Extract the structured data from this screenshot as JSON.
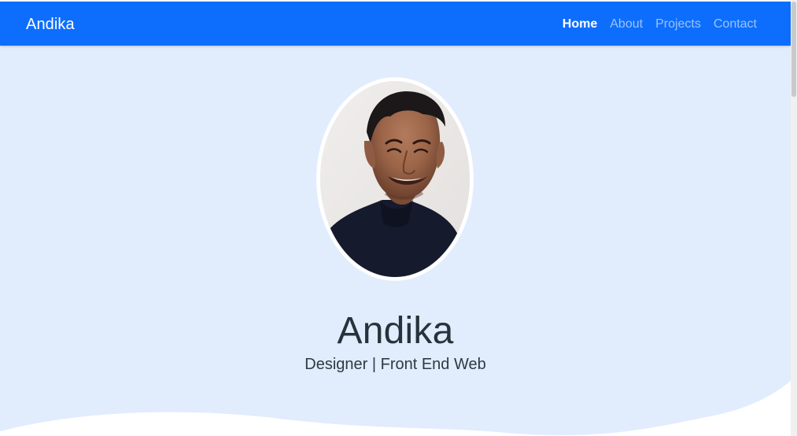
{
  "navbar": {
    "brand": "Andika",
    "links": [
      {
        "label": "Home",
        "active": true
      },
      {
        "label": "About",
        "active": false
      },
      {
        "label": "Projects",
        "active": false
      },
      {
        "label": "Contact",
        "active": false
      }
    ]
  },
  "hero": {
    "name": "Andika",
    "subtitle": "Designer | Front End Web"
  },
  "colors": {
    "navbar": "#0d6efd",
    "hero_background": "#e1ecfd",
    "wave": "#ffffff"
  }
}
